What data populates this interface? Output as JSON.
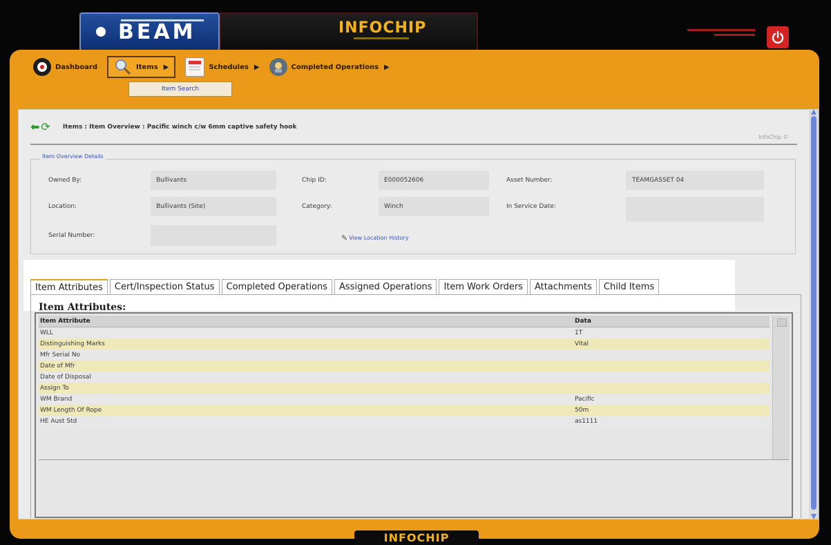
{
  "header": {
    "beam_logo": "BEAM",
    "infochip_logo": "INFOCHIP"
  },
  "nav": {
    "items": [
      {
        "label": "Dashboard",
        "icon": "dashboard-icon"
      },
      {
        "label": "Items",
        "icon": "magnifier-icon"
      },
      {
        "label": "Schedules",
        "icon": "calendar-icon"
      },
      {
        "label": "Completed Operations",
        "icon": "operations-icon"
      }
    ],
    "active": "Items",
    "submenu_item": "Item Search"
  },
  "page": {
    "breadcrumb": "Items : Item Overview : Pacific winch c/w 6mm captive safety hook",
    "brand": "InfoChip ©"
  },
  "overview": {
    "legend": "Item Overview Details",
    "owned_by_label": "Owned By:",
    "owned_by_value": "Bullivants",
    "chip_id_label": "Chip ID:",
    "chip_id_value": "E000052606",
    "asset_number_label": "Asset Number:",
    "asset_number_value": "TEAMGASSET 04",
    "location_label": "Location:",
    "location_value": "Bullivants (Site)",
    "category_label": "Category:",
    "category_value": "Winch",
    "in_service_label": "In Service Date:",
    "serial_number_label": "Serial Number:",
    "view_location_history": "View Location History"
  },
  "tabs": [
    "Item Attributes",
    "Cert/Inspection Status",
    "Completed Operations",
    "Assigned Operations",
    "Item Work Orders",
    "Attachments",
    "Child Items"
  ],
  "attributes": {
    "title": "Item Attributes:",
    "col_attribute": "Item Attribute",
    "col_data": "Data",
    "rows": [
      {
        "attribute": "WLL",
        "data": "1T"
      },
      {
        "attribute": "Distinguishing Marks",
        "data": "Vital"
      },
      {
        "attribute": "Mfr Serial No",
        "data": ""
      },
      {
        "attribute": "Date of Mfr",
        "data": ""
      },
      {
        "attribute": "Date of Disposal",
        "data": ""
      },
      {
        "attribute": "Assign To",
        "data": ""
      },
      {
        "attribute": "WM Brand",
        "data": "Pacific"
      },
      {
        "attribute": "WM Length Of Rope",
        "data": "50m"
      },
      {
        "attribute": "HE Aust Std",
        "data": "as1111"
      }
    ]
  },
  "footer": {
    "brand": "INFOCHIP"
  },
  "colors": {
    "frame_orange": "#ea9a18",
    "tab_active_accent": "#e9a21b",
    "row_highlight": "#efe8b8",
    "link_blue": "#3b53b2",
    "power_red": "#d32323"
  }
}
